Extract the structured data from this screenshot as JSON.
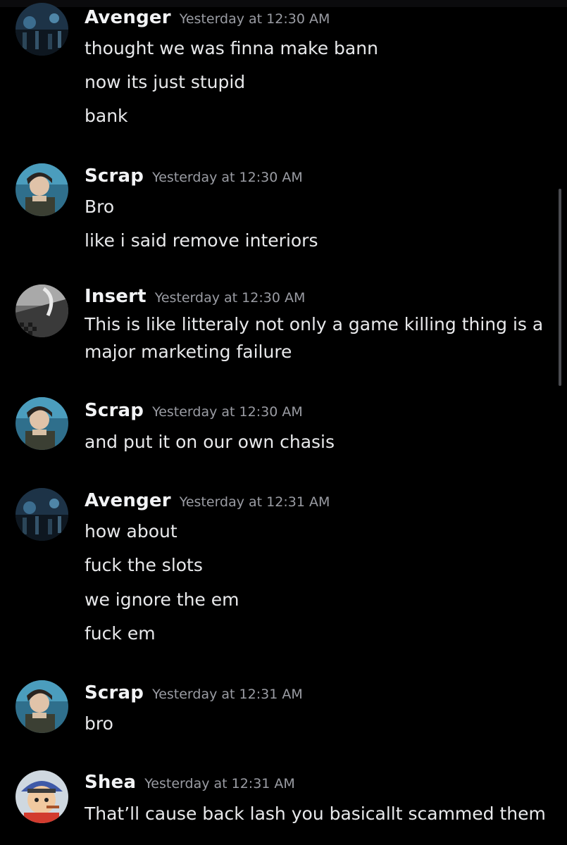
{
  "messages": [
    {
      "author": "Avenger",
      "timestamp": "Yesterday at 12:30 AM",
      "avatar": "avatar-avenger",
      "lines": [
        "thought we was finna make bann",
        "now its just stupid",
        "bank"
      ]
    },
    {
      "author": "Scrap",
      "timestamp": "Yesterday at 12:30 AM",
      "avatar": "avatar-scrap",
      "lines": [
        "Bro",
        "like i said remove interiors"
      ]
    },
    {
      "author": "Insert",
      "timestamp": "Yesterday at 12:30 AM",
      "avatar": "avatar-insert",
      "lines": [
        "This is like litteraly not only a game killing thing is a",
        "major marketing failure"
      ]
    },
    {
      "author": "Scrap",
      "timestamp": "Yesterday at 12:30 AM",
      "avatar": "avatar-scrap",
      "lines": [
        "and put it on our own chasis"
      ]
    },
    {
      "author": "Avenger",
      "timestamp": "Yesterday at 12:31 AM",
      "avatar": "avatar-avenger",
      "lines": [
        "how about",
        "fuck the slots",
        "we ignore the em",
        "fuck em"
      ]
    },
    {
      "author": "Scrap",
      "timestamp": "Yesterday at 12:31 AM",
      "avatar": "avatar-scrap",
      "lines": [
        "bro"
      ]
    },
    {
      "author": "Shea",
      "timestamp": "Yesterday at 12:31 AM",
      "avatar": "avatar-shea",
      "lines": [
        "That’ll cause back lash you basicallt scammed them"
      ]
    }
  ]
}
